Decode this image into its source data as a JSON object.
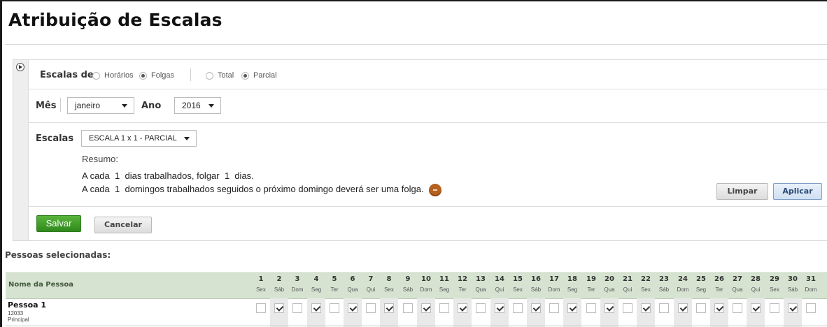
{
  "page": {
    "title": "Atribuição de Escalas"
  },
  "filters": {
    "escalas_de_label": "Escalas de",
    "type_options": [
      {
        "label": "Horários",
        "selected": false
      },
      {
        "label": "Folgas",
        "selected": true
      }
    ],
    "scope_options": [
      {
        "label": "Total",
        "selected": false
      },
      {
        "label": "Parcial",
        "selected": true
      }
    ],
    "mes_label": "Mês",
    "mes_value": "janeiro",
    "ano_label": "Ano",
    "ano_value": "2016",
    "escalas_label": "Escalas",
    "escala_value": "ESCALA 1 x 1 - PARCIAL"
  },
  "summary": {
    "title": "Resumo:",
    "line1": {
      "pre": "A cada",
      "n1": "1",
      "mid": "dias trabalhados, folgar",
      "n2": "1",
      "post": "dias."
    },
    "line2": {
      "pre": "A cada",
      "n1": "1",
      "post": "domingos trabalhados seguidos o próximo domingo deverá ser uma folga."
    },
    "info_icon": "minus-circle-icon"
  },
  "buttons": {
    "limpar": "Limpar",
    "aplicar": "Aplicar",
    "salvar": "Salvar",
    "cancelar": "Cancelar"
  },
  "colors": {
    "save": "#2f8a1c",
    "apply": "#cfdff2",
    "grid_header": "#d6e3d1",
    "info": "#b5611f"
  },
  "people": {
    "title": "Pessoas selecionadas:",
    "name_column": "Nome da Pessoa",
    "days": [
      {
        "n": "1",
        "d": "Sex"
      },
      {
        "n": "2",
        "d": "Sáb"
      },
      {
        "n": "3",
        "d": "Dom"
      },
      {
        "n": "4",
        "d": "Seg"
      },
      {
        "n": "5",
        "d": "Ter"
      },
      {
        "n": "6",
        "d": "Qua"
      },
      {
        "n": "7",
        "d": "Qui"
      },
      {
        "n": "8",
        "d": "Sex"
      },
      {
        "n": "9",
        "d": "Sáb"
      },
      {
        "n": "10",
        "d": "Dom"
      },
      {
        "n": "11",
        "d": "Seg"
      },
      {
        "n": "12",
        "d": "Ter"
      },
      {
        "n": "13",
        "d": "Qua"
      },
      {
        "n": "14",
        "d": "Qui"
      },
      {
        "n": "15",
        "d": "Sex"
      },
      {
        "n": "16",
        "d": "Sáb"
      },
      {
        "n": "17",
        "d": "Dom"
      },
      {
        "n": "18",
        "d": "Seg"
      },
      {
        "n": "19",
        "d": "Ter"
      },
      {
        "n": "20",
        "d": "Qua"
      },
      {
        "n": "21",
        "d": "Qui"
      },
      {
        "n": "22",
        "d": "Sex"
      },
      {
        "n": "23",
        "d": "Sáb"
      },
      {
        "n": "24",
        "d": "Dom"
      },
      {
        "n": "25",
        "d": "Seg"
      },
      {
        "n": "26",
        "d": "Ter"
      },
      {
        "n": "27",
        "d": "Qua"
      },
      {
        "n": "28",
        "d": "Qui"
      },
      {
        "n": "29",
        "d": "Sex"
      },
      {
        "n": "30",
        "d": "Sáb"
      },
      {
        "n": "31",
        "d": "Dom"
      }
    ],
    "rows": [
      {
        "name": "Pessoa 1",
        "id": "12033",
        "role": "Principal",
        "checks": [
          false,
          true,
          false,
          true,
          false,
          true,
          false,
          true,
          false,
          true,
          false,
          true,
          false,
          true,
          false,
          true,
          false,
          true,
          false,
          true,
          false,
          true,
          false,
          true,
          false,
          true,
          false,
          true,
          false,
          true,
          false
        ]
      }
    ]
  }
}
